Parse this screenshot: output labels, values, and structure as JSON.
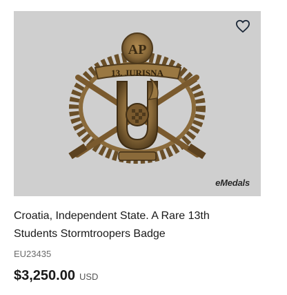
{
  "listing": {
    "title_line1": "Croatia, Independent State. A Rare 13th",
    "title_line2": "Students Stormtroopers Badge",
    "sku": "EU23435",
    "price": "$3,250.00",
    "currency": "USD",
    "badge_banner_text": "13. JURISNA",
    "badge_top_monogram": "AP"
  },
  "image": {
    "watermark": "eMedals",
    "background_color": "#cfcfcf",
    "badge_color": "#8a6a3a"
  },
  "icons": {
    "favorite": "heart-outline-icon"
  }
}
